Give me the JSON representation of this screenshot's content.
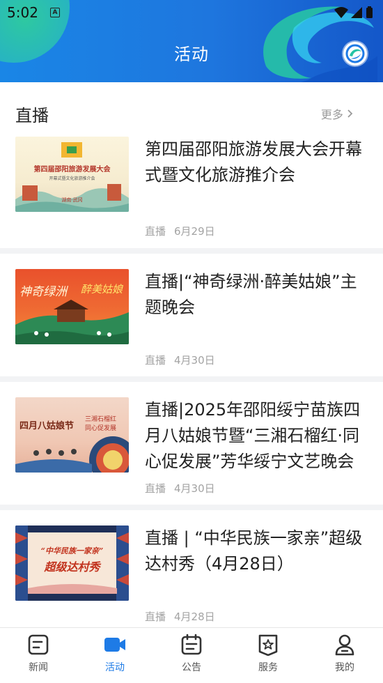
{
  "status_bar": {
    "time": "5:02",
    "app_icon_letter": "A"
  },
  "header": {
    "title": "活动"
  },
  "section": {
    "title": "直播",
    "more_label": "更多"
  },
  "cards": [
    {
      "title": "第四届邵阳旅游发展大会开幕式暨文化旅游推介会",
      "tag": "直播",
      "date": "6月29日",
      "thumb_lines": [
        "第四届邵阳旅游发展大会",
        "开幕式暨文化旅游推介会",
        "湖南·武冈"
      ]
    },
    {
      "title": "直播|“神奇绿洲·醉美姑娘”主题晚会",
      "tag": "直播",
      "date": "4月30日",
      "thumb_lines": [
        "神奇绿洲",
        "醉美姑娘"
      ]
    },
    {
      "title": "直播|2025年邵阳绥宁苗族四月八姑娘节暨“三湘石榴红·同心促发展”芳华绥宁文艺晚会",
      "tag": "直播",
      "date": "4月30日",
      "thumb_lines": [
        "四月八姑娘节",
        "三湘石榴红",
        "同心促发展"
      ]
    },
    {
      "title": "直播 | “中华民族一家亲”超级达村秀（4月28日）",
      "tag": "直播",
      "date": "4月28日",
      "thumb_lines": [
        "“中华民族一家亲”",
        "超级达村秀"
      ]
    }
  ],
  "nav": {
    "items": [
      {
        "label": "新闻",
        "icon": "news-icon"
      },
      {
        "label": "活动",
        "icon": "video-camera-icon"
      },
      {
        "label": "公告",
        "icon": "notice-icon"
      },
      {
        "label": "服务",
        "icon": "service-icon"
      },
      {
        "label": "我的",
        "icon": "profile-icon"
      }
    ],
    "active_index": 1
  },
  "colors": {
    "accent": "#1e7be6",
    "header_start": "#1a86e6",
    "header_end": "#1457c9"
  }
}
